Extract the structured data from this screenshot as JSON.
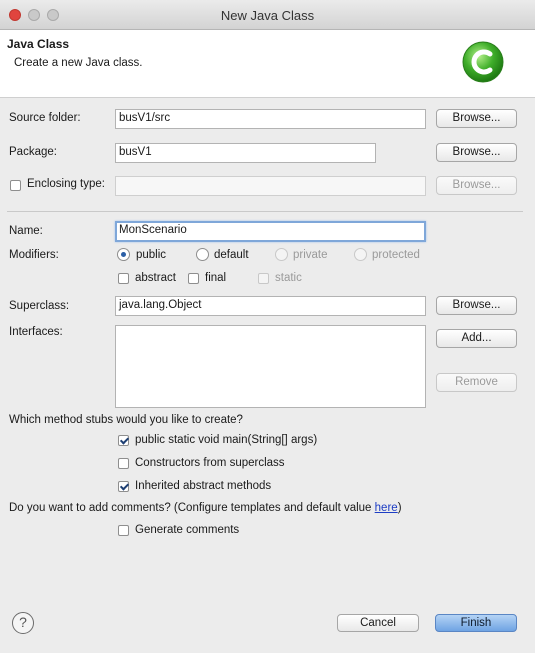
{
  "window": {
    "title": "New Java Class"
  },
  "header": {
    "title": "Java Class",
    "description": "Create a new Java class."
  },
  "source_folder": {
    "label": "Source folder:",
    "value": "busV1/src",
    "browse": "Browse..."
  },
  "package": {
    "label": "Package:",
    "value": "busV1",
    "browse": "Browse..."
  },
  "enclosing": {
    "label": "Enclosing type:",
    "value": "",
    "checked": false,
    "browse": "Browse..."
  },
  "name": {
    "label": "Name:",
    "value": "MonScenario"
  },
  "modifiers": {
    "label": "Modifiers:",
    "access": [
      {
        "label": "public",
        "selected": true
      },
      {
        "label": "default",
        "selected": false
      },
      {
        "label": "private",
        "selected": false,
        "disabled": true
      },
      {
        "label": "protected",
        "selected": false,
        "disabled": true
      }
    ],
    "flags": [
      {
        "label": "abstract",
        "checked": false
      },
      {
        "label": "final",
        "checked": false
      },
      {
        "label": "static",
        "checked": false,
        "disabled": true
      }
    ]
  },
  "superclass": {
    "label": "Superclass:",
    "value": "java.lang.Object",
    "browse": "Browse..."
  },
  "interfaces": {
    "label": "Interfaces:",
    "add": "Add...",
    "remove": "Remove"
  },
  "stubs": {
    "question": "Which method stubs would you like to create?",
    "options": [
      {
        "label": "public static void main(String[] args)",
        "checked": true
      },
      {
        "label": "Constructors from superclass",
        "checked": false
      },
      {
        "label": "Inherited abstract methods",
        "checked": true
      }
    ]
  },
  "comments": {
    "question_before": "Do you want to add comments? (Configure templates and default value ",
    "link": "here",
    "question_after": ")",
    "option": {
      "label": "Generate comments",
      "checked": false
    }
  },
  "footer": {
    "help": "?",
    "cancel": "Cancel",
    "finish": "Finish"
  },
  "colors": {
    "accent": "#6fa3e3",
    "close_light": "#e0443e",
    "link": "#1d3dc4",
    "logo_green": "#3fae2a"
  }
}
